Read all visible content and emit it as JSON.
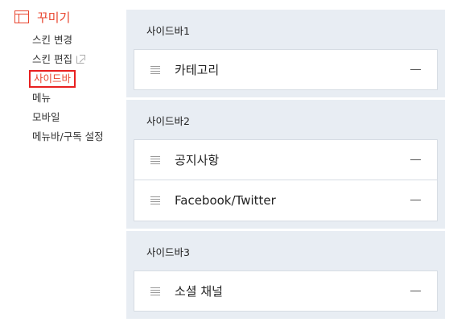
{
  "nav": {
    "title": "꾸미기",
    "items": [
      {
        "label": "스킨 변경"
      },
      {
        "label": "스킨 편집"
      },
      {
        "label": "사이드바"
      },
      {
        "label": "메뉴"
      },
      {
        "label": "모바일"
      },
      {
        "label": "메뉴바/구독 설정"
      }
    ]
  },
  "sidebars": [
    {
      "title": "사이드바1",
      "items": [
        "카테고리"
      ]
    },
    {
      "title": "사이드바2",
      "items": [
        "공지사항",
        "Facebook/Twitter"
      ]
    },
    {
      "title": "사이드바3",
      "items": [
        "소셜 채널"
      ]
    }
  ],
  "colors": {
    "accent": "#e8452f",
    "panel": "#e8edf3"
  }
}
